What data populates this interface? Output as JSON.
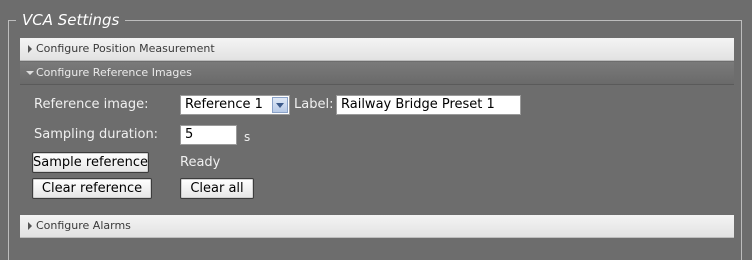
{
  "legend": "VCA Settings",
  "sections": {
    "position": {
      "label": "Configure Position Measurement"
    },
    "reference": {
      "label": "Configure Reference Images"
    },
    "alarms": {
      "label": "Configure Alarms"
    }
  },
  "form": {
    "reference_label": "Reference image:",
    "reference_value": "Reference 1",
    "label_caption": "Label:",
    "label_value": "Railway Bridge Preset 1",
    "sampling_label": "Sampling duration:",
    "sampling_value": "5",
    "sampling_unit": "s",
    "sample_button": "Sample reference",
    "status": "Ready",
    "clear_reference_button": "Clear reference",
    "clear_all_button": "Clear all"
  },
  "colors": {
    "background": "#6d6d6d",
    "accent": "#3c5a8a"
  }
}
